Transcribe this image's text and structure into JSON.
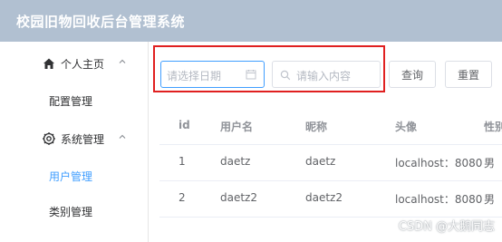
{
  "header": {
    "title": "校园旧物回收后台管理系统",
    "bg_color": "#b1c0d1"
  },
  "sidebar": {
    "groups": [
      {
        "label": "个人主页",
        "icon": "home-icon",
        "items": [
          {
            "label": "配置管理",
            "active": false
          }
        ]
      },
      {
        "label": "系统管理",
        "icon": "gear-icon",
        "items": [
          {
            "label": "用户管理",
            "active": true
          },
          {
            "label": "类别管理",
            "active": false
          }
        ]
      }
    ],
    "active_color": "#409eff"
  },
  "search": {
    "date_placeholder": "请选择日期",
    "keyword_placeholder": "请输入内容",
    "query_label": "查询",
    "reset_label": "重置",
    "highlight_color": "#e02020"
  },
  "table": {
    "columns": [
      "id",
      "用户名",
      "昵称",
      "头像",
      "性别"
    ],
    "rows": [
      [
        "1",
        "daetz",
        "daetz",
        "localhost：8080",
        "男"
      ],
      [
        "2",
        "daetz2",
        "daetz2",
        "localhost：8080",
        "男"
      ]
    ]
  },
  "watermark": "CSDN @大鹅同志"
}
